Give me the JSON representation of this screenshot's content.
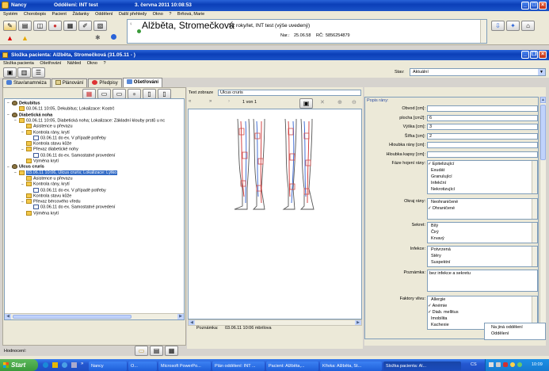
{
  "app": {
    "title_user": "Nancy",
    "title_dept": "Oddělení: INT test",
    "title_date": "3. června 2011 10:08:53",
    "menu": [
      "Systém",
      "Chorobopis",
      "Pacient",
      "Žádanky",
      "Oddělení",
      "Další přehledy",
      "Okno",
      "?",
      "Brňová, Marie"
    ],
    "patient_name": "Alžběta, Stromečková",
    "patient_info": "52 roky/let, INT test  (výše uvedený)",
    "nar_label": "Nar.:",
    "nar_value": "25.06.58",
    "rc_label": "RČ:",
    "rc_value": "5856254879"
  },
  "window": {
    "title": "Složka pacienta: Alžběta, Stromečková (31.05.11 - )",
    "menu": [
      "Složka pacienta",
      "Ošetřování",
      "Náhled",
      "Okno",
      "?"
    ],
    "stav_label": "Stav:",
    "stav_value": "Aktuální",
    "tabs": [
      "Stav/anamnéza",
      "Plánování",
      "Předpisy",
      "Ošetřování"
    ]
  },
  "tree": {
    "items": [
      {
        "level": 0,
        "icon": "disease",
        "text": "Dekubitus",
        "expand": "−"
      },
      {
        "level": 1,
        "icon": "folder",
        "text": "03.06.11 10:05, Dekubitus; Lokalizace: Kostrč",
        "expand": ""
      },
      {
        "level": 0,
        "icon": "disease",
        "text": "Diabetická noha",
        "expand": "−"
      },
      {
        "level": 1,
        "icon": "folder",
        "text": "03.06.11 10:05, Diabetická noha; Lokalizace: Základní klouby prstů u nc",
        "expand": "−"
      },
      {
        "level": 2,
        "icon": "folder",
        "text": "Asistence u převazu",
        "expand": ""
      },
      {
        "level": 2,
        "icon": "folder",
        "text": "Kontrola rány, krytí",
        "expand": "−"
      },
      {
        "level": 3,
        "icon": "doc",
        "text": "03.06.11 do ex. V případě potřeby",
        "expand": ""
      },
      {
        "level": 2,
        "icon": "folder",
        "text": "Kontrola stavu  kůže",
        "expand": ""
      },
      {
        "level": 2,
        "icon": "folder",
        "text": "Převaz diabetické nohy",
        "expand": "−"
      },
      {
        "level": 3,
        "icon": "doc",
        "text": "03.06.11 do ex. Samostatné provedení",
        "expand": ""
      },
      {
        "level": 2,
        "icon": "folder",
        "text": "Výměna krytí",
        "expand": ""
      },
      {
        "level": 0,
        "icon": "disease",
        "text": "Ulcus cruris",
        "expand": "−"
      },
      {
        "level": 1,
        "icon": "folder",
        "text": "03.06.11 10:06, Ulcus cruris; Lokalizace: Lýtko",
        "expand": "−",
        "selected": true
      },
      {
        "level": 2,
        "icon": "folder",
        "text": "Asistence u převazu",
        "expand": ""
      },
      {
        "level": 2,
        "icon": "folder",
        "text": "Kontrola rány, krytí",
        "expand": "−"
      },
      {
        "level": 3,
        "icon": "doc",
        "text": "03.06.11 do ex. V případě potřeby",
        "expand": ""
      },
      {
        "level": 2,
        "icon": "folder",
        "text": "Kontrola stavu  kůže",
        "expand": ""
      },
      {
        "level": 2,
        "icon": "folder",
        "text": "Převaz bércového vředu",
        "expand": "−"
      },
      {
        "level": 3,
        "icon": "doc",
        "text": "03.06.11 do ex. Samostatné provedení",
        "expand": ""
      },
      {
        "level": 2,
        "icon": "folder",
        "text": "Výměna krytí",
        "expand": ""
      }
    ]
  },
  "hodnoceni_label": "Hodnocení:",
  "viewer": {
    "text_label": "Text zobraze",
    "text_value": "Ulcus cruris",
    "page_counter": "1 von 1",
    "note_label": "Poznámka:",
    "note_value": "03.06.11 10:06 mbrilova"
  },
  "wound": {
    "header": "Popis rány:",
    "fields": [
      {
        "label": "Obvod [cm]:",
        "value": ""
      },
      {
        "label": "plocha [cm2]:",
        "value": "6"
      },
      {
        "label": "Výška [cm]:",
        "value": "3"
      },
      {
        "label": "Šířka [cm]:",
        "value": "2"
      },
      {
        "label": "Hloubka rány [cm]:",
        "value": ""
      },
      {
        "label": "Hloubka kapsy [cm]:",
        "value": ""
      }
    ],
    "faze_label": "Fáze hojení rány:",
    "faze_options": [
      {
        "text": "Epitelizující",
        "checked": true
      },
      {
        "text": "Exudát",
        "checked": false
      },
      {
        "text": "Granulující",
        "checked": false
      },
      {
        "text": "Infekční",
        "checked": false
      },
      {
        "text": "Nekrotizující",
        "checked": false
      }
    ],
    "okraj_label": "Okraj rány:",
    "okraj_options": [
      {
        "text": "Neohraničené",
        "checked": false
      },
      {
        "text": "Ohraničené",
        "checked": true
      }
    ],
    "sekret_label": "Sekret:",
    "sekret_options": [
      {
        "text": "Bílý",
        "checked": false
      },
      {
        "text": "Čirý",
        "checked": false
      },
      {
        "text": "Krvavý",
        "checked": false
      }
    ],
    "infekce_label": "Infekce:",
    "infekce_options": [
      {
        "text": "Potvrzená",
        "checked": false
      },
      {
        "text": "Stěry",
        "checked": false
      },
      {
        "text": "Suspektní",
        "checked": false
      }
    ],
    "poznamka_label": "Poznámka:",
    "poznamka_value": "bez infekce a sekretu",
    "faktory_label": "Faktory vlivu:",
    "faktory_options": [
      {
        "text": "Allergie",
        "checked": false
      },
      {
        "text": "Anémie",
        "checked": true
      },
      {
        "text": "Diab. mellitus",
        "checked": true
      },
      {
        "text": "Imobilita",
        "checked": false
      },
      {
        "text": "Kachexie",
        "checked": false
      }
    ]
  },
  "popup": [
    "Na jiná oddělení",
    "Oddělení"
  ],
  "taskbar": {
    "start": "Start",
    "buttons": [
      "Nancy",
      "O...",
      "Microsoft PowerPo...",
      "Plán oddělení: INT ...",
      "Pacient: Alžběta,...",
      "Křivka: Alžběta, St...",
      "Složka pacienta: Al...",
      "CS"
    ],
    "clock": "10:09"
  },
  "colors": {
    "selection": "#316ac5",
    "xp_blue": "#0b3fb8",
    "window_bg": "#ece9d8",
    "start_green": "#3a9a3a"
  }
}
